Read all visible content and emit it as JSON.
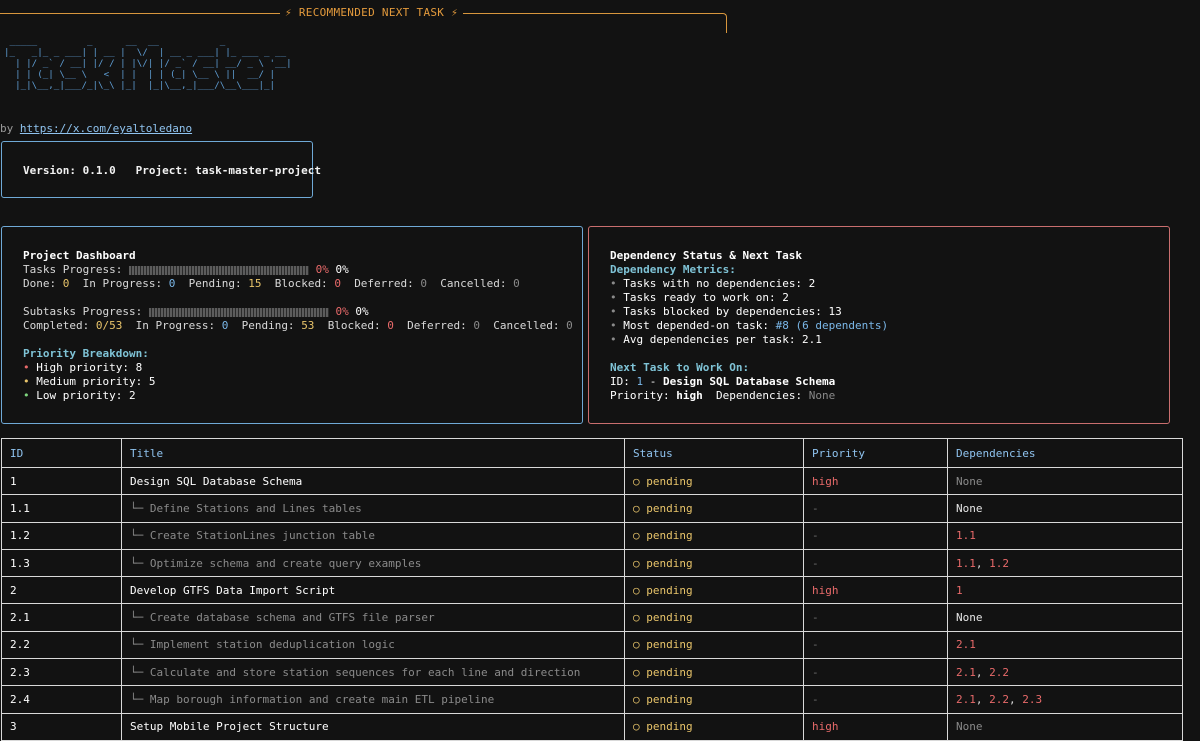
{
  "banner": {
    "title": "⚡ RECOMMENDED NEXT TASK ⚡"
  },
  "logo": {
    "ascii": " _____         _      __  __           _\n|_   _|_ _ ___| | __ |  \\/  | __ _ ___| |_ ___ _ __\n  | |/ _` / __| |/ / | |\\/| |/ _` / __| __/ _ \\ '__|\n  | | (_| \\__ \\   <  | |  | | (_| \\__ \\ ||  __/ |\n  |_|\\__,_|___/_|\\_\\ |_|  |_|\\__,_|___/\\__\\___|_|"
  },
  "byline": {
    "prefix": "by ",
    "link": "https://x.com/eyaltoledano"
  },
  "version_box": {
    "version_label": "Version: ",
    "version": "0.1.0",
    "project_label": "Project: ",
    "project": "task-master-project"
  },
  "dashboard": {
    "title": "Project Dashboard",
    "tasks_progress_label": "Tasks Progress: ",
    "tasks_pct_colored": "0%",
    "tasks_pct": "0%",
    "tasks_counts": {
      "done_label": "Done: ",
      "done": "0",
      "in_progress_label": "In Progress: ",
      "in_progress": "0",
      "pending_label": "Pending: ",
      "pending": "15",
      "blocked_label": "Blocked: ",
      "blocked": "0",
      "deferred_label": "Deferred: ",
      "deferred": "0",
      "cancelled_label": "Cancelled: ",
      "cancelled": "0"
    },
    "subtasks_progress_label": "Subtasks Progress: ",
    "subtasks_pct_colored": "0%",
    "subtasks_pct": "0%",
    "subtasks_counts": {
      "completed_label": "Completed: ",
      "completed": "0/53",
      "in_progress_label": "In Progress: ",
      "in_progress": "0",
      "pending_label": "Pending: ",
      "pending": "53",
      "blocked_label": "Blocked: ",
      "blocked": "0",
      "deferred_label": "Deferred: ",
      "deferred": "0",
      "cancelled_label": "Cancelled: ",
      "cancelled": "0"
    },
    "priority_title": "Priority Breakdown:",
    "priorities": [
      {
        "bullet": "•",
        "text": "High priority: 8",
        "color": "#e86a6a"
      },
      {
        "bullet": "•",
        "text": "Medium priority: 5",
        "color": "#e8c46a"
      },
      {
        "bullet": "•",
        "text": "Low priority: 2",
        "color": "#7fd67f"
      }
    ]
  },
  "dependency_panel": {
    "title": "Dependency Status & Next Task",
    "metrics_title": "Dependency Metrics:",
    "metrics": [
      "Tasks with no dependencies: 2",
      "Tasks ready to work on: 2",
      "Tasks blocked by dependencies: 13"
    ],
    "most_depended_label": "Most depended-on task: ",
    "most_depended_id": "#8",
    "most_depended_count": "(6 dependents)",
    "avg_label": "Avg dependencies per task: 2.1",
    "next_title": "Next Task to Work On:",
    "next_id_label": "ID: ",
    "next_id": "1",
    "next_sep": " - ",
    "next_name": "Design SQL Database Schema",
    "next_priority_label": "Priority: ",
    "next_priority": "high",
    "next_deps_label": "Dependencies: ",
    "next_deps": "None"
  },
  "table": {
    "headers": [
      "ID",
      "Title",
      "Status",
      "Priority",
      "Dependencies"
    ],
    "rows": [
      {
        "id": "1",
        "title": "Design SQL Database Schema",
        "sub": false,
        "status": "pending",
        "priority": "high",
        "deps": [
          "None"
        ],
        "deps_none_style": "dim"
      },
      {
        "id": "1.1",
        "title": "Define Stations and Lines tables",
        "sub": true,
        "status": "pending",
        "priority": "-",
        "deps": [
          "None"
        ],
        "deps_none_style": "bright"
      },
      {
        "id": "1.2",
        "title": "Create StationLines junction table",
        "sub": true,
        "status": "pending",
        "priority": "-",
        "deps": [
          "1.1"
        ]
      },
      {
        "id": "1.3",
        "title": "Optimize schema and create query examples",
        "sub": true,
        "status": "pending",
        "priority": "-",
        "deps": [
          "1.1",
          "1.2"
        ]
      },
      {
        "id": "2",
        "title": "Develop GTFS Data Import Script",
        "sub": false,
        "status": "pending",
        "priority": "high",
        "deps": [
          "1"
        ]
      },
      {
        "id": "2.1",
        "title": "Create database schema and GTFS file parser",
        "sub": true,
        "status": "pending",
        "priority": "-",
        "deps": [
          "None"
        ],
        "deps_none_style": "bright"
      },
      {
        "id": "2.2",
        "title": "Implement station deduplication logic",
        "sub": true,
        "status": "pending",
        "priority": "-",
        "deps": [
          "2.1"
        ]
      },
      {
        "id": "2.3",
        "title": "Calculate and store station sequences for each line and direction",
        "sub": true,
        "status": "pending",
        "priority": "-",
        "deps": [
          "2.1",
          "2.2"
        ]
      },
      {
        "id": "2.4",
        "title": "Map borough information and create main ETL pipeline",
        "sub": true,
        "status": "pending",
        "priority": "-",
        "deps": [
          "2.1",
          "2.2",
          "2.3"
        ]
      },
      {
        "id": "3",
        "title": "Setup Mobile Project Structure",
        "sub": false,
        "status": "pending",
        "priority": "high",
        "deps": [
          "None"
        ],
        "deps_none_style": "dim"
      }
    ],
    "status_icon": "○",
    "sub_prefix": "└─ "
  }
}
